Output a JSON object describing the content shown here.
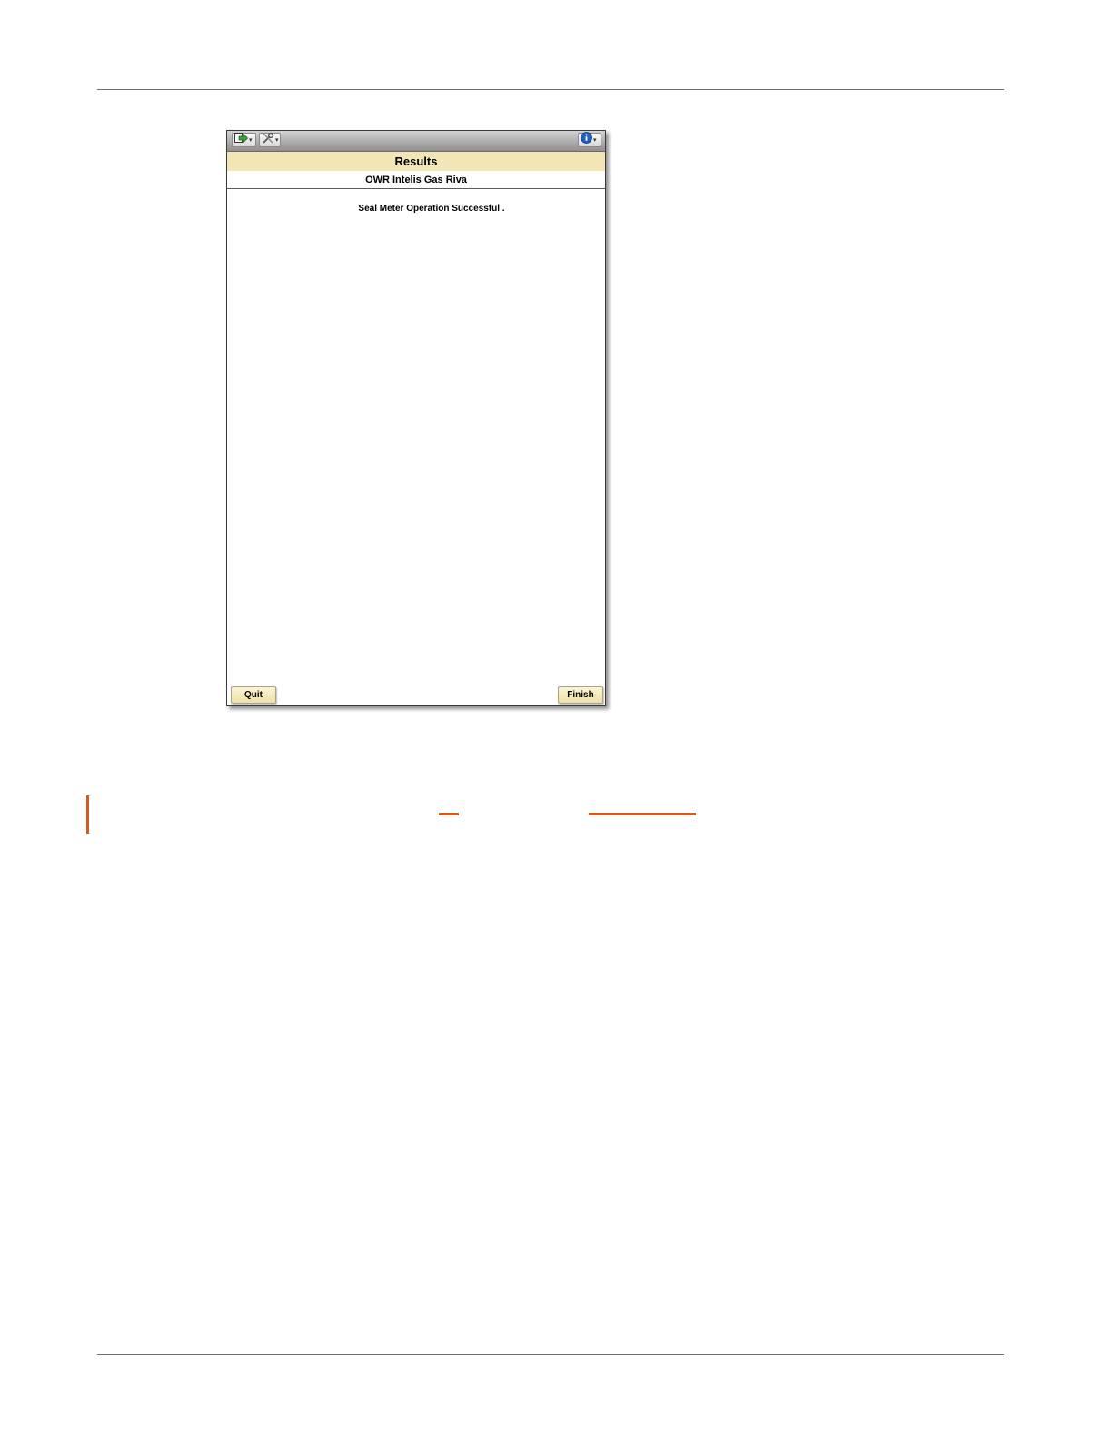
{
  "screen": {
    "title": "Results",
    "subtitle": "OWR Intelis Gas Riva",
    "message": "Seal Meter Operation Successful ."
  },
  "toolbar": {
    "icons": [
      "exit-icon",
      "tools-icon",
      "info-icon"
    ]
  },
  "buttons": {
    "quit": "Quit",
    "finish": "Finish"
  },
  "colors": {
    "header_band": "#f3e6b6",
    "button_fill": "#f0e0a4",
    "accent": "#d45a1e",
    "info_blue": "#1f5fbf",
    "exit_green": "#3aa33a"
  }
}
